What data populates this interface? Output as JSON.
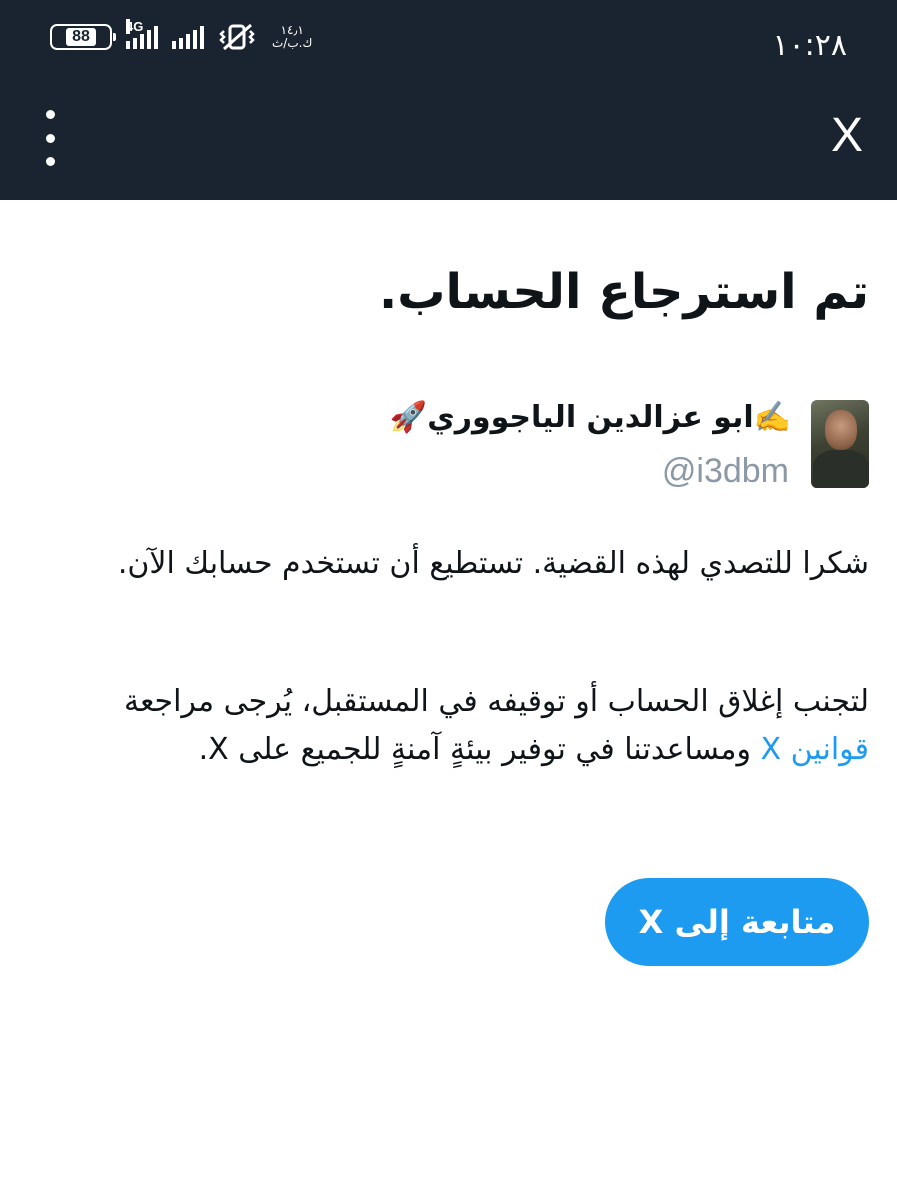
{
  "status_bar": {
    "time": "١٠:٢٨",
    "battery": "88",
    "network_type": "4G",
    "speed_value": "١٤٫١",
    "speed_unit": "ك.ب/ث"
  },
  "app_bar": {
    "logo": "X",
    "menu_icon": "more-vertical-icon"
  },
  "main": {
    "title": "تم استرجاع الحساب.",
    "user": {
      "name": "✍️ابو عزالدين الياجووري🚀",
      "handle": "@i3dbm"
    },
    "paragraph1": "شكرا للتصدي لهذه القضية. تستطيع أن تستخدم حسابك الآن.",
    "paragraph2_part1": "لتجنب إغلاق الحساب أو توقيفه في المستقبل، يُرجى مراجعة",
    "paragraph2_link": "قوانين X",
    "paragraph2_part2": "ومساعدتنا في توفير بيئةٍ آمنةٍ للجميع على X.",
    "continue_button": "متابعة إلى X"
  },
  "colors": {
    "top_bar": "#1a2430",
    "accent": "#1d9bf0",
    "text": "#0f1419",
    "secondary_text": "#8b98a5"
  }
}
